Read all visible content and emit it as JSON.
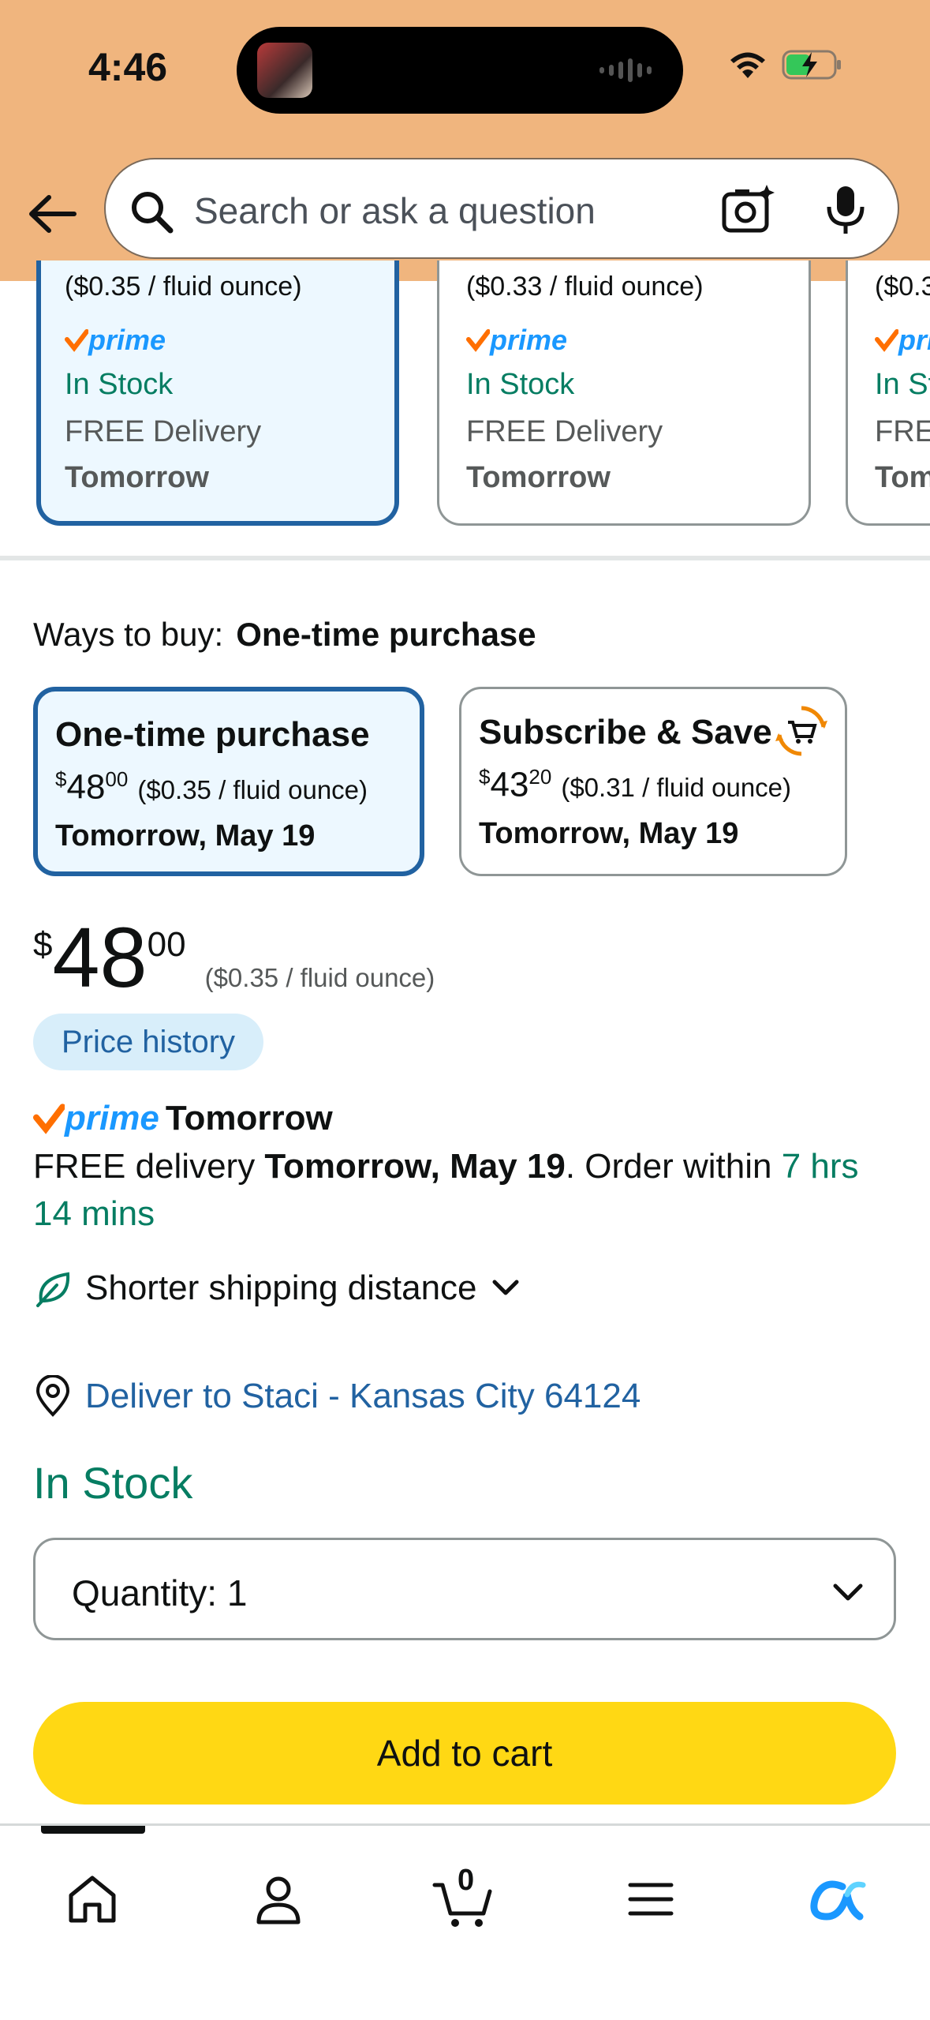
{
  "status_bar": {
    "time": "4:46"
  },
  "search": {
    "placeholder": "Search or ask a question"
  },
  "variant_cards": [
    {
      "price_per_unit": "($0.35 / fluid ounce)",
      "prime": "prime",
      "stock": "In Stock",
      "delivery": "FREE Delivery",
      "when": "Tomorrow",
      "selected": true
    },
    {
      "price_per_unit": "($0.33 / fluid ounce)",
      "prime": "prime",
      "stock": "In Stock",
      "delivery": "FREE Delivery",
      "when": "Tomorrow",
      "selected": false
    },
    {
      "price_per_unit": "($0.3",
      "prime": "pri",
      "stock": "In St",
      "delivery": "FRE",
      "when": "Tom",
      "selected": false
    }
  ],
  "ways_to_buy": {
    "label": "Ways to buy:",
    "selected": "One-time purchase",
    "options": [
      {
        "title": "One-time purchase",
        "currency": "$",
        "whole": "48",
        "fraction": "00",
        "unit": "($0.35 / fluid ounce)",
        "delivery": "Tomorrow, May 19",
        "selected": true
      },
      {
        "title": "Subscribe & Save",
        "currency": "$",
        "whole": "43",
        "fraction": "20",
        "unit": "($0.31 / fluid ounce)",
        "delivery": "Tomorrow, May 19",
        "selected": false
      }
    ]
  },
  "price": {
    "currency": "$",
    "whole": "48",
    "fraction": "00",
    "unit": "($0.35 / fluid ounce)"
  },
  "price_history": "Price history",
  "prime_delivery": {
    "prime": "prime",
    "speed": "Tomorrow",
    "prefix": "FREE delivery ",
    "date": "Tomorrow, May 19",
    "middle": ". Order within ",
    "countdown": "7 hrs 14 mins"
  },
  "shipping": {
    "label": "Shorter shipping distance"
  },
  "deliver_to": "Deliver to Staci - Kansas City 64124",
  "stock_status": "In Stock",
  "quantity": {
    "label": "Quantity:",
    "value": "1"
  },
  "add_to_cart": "Add to cart",
  "tabbar": {
    "cart_count": "0",
    "active_tab": "home"
  },
  "colors": {
    "header_bg": "#f0b57e",
    "selected_border": "#2162a1",
    "green": "#067d62",
    "cart_button": "#ffd814",
    "link": "#2162a1",
    "prime_blue": "#1a98ff",
    "prime_check": "#ff6f00"
  }
}
